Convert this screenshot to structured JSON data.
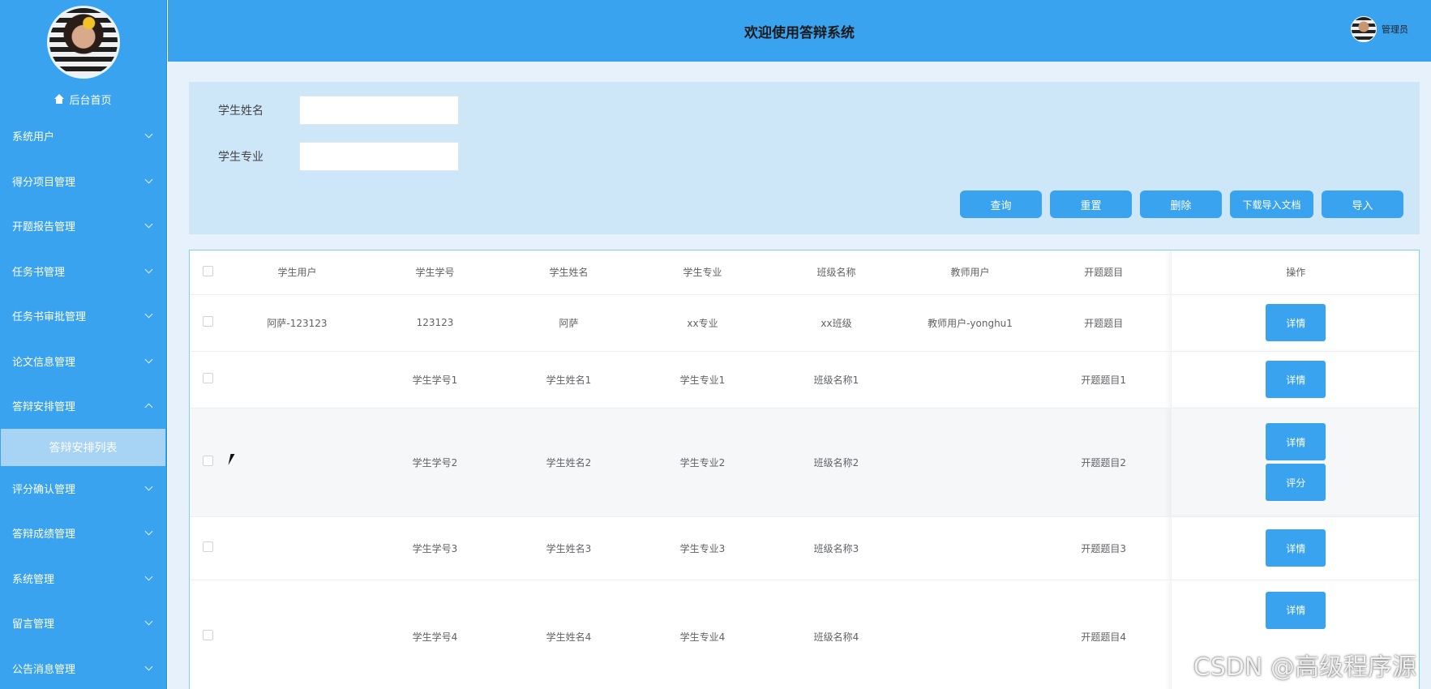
{
  "header": {
    "title": "欢迎使用答辩系统",
    "user_name": "管理员"
  },
  "sidebar": {
    "home_label": "后台首页",
    "items": [
      {
        "label": "系统用户",
        "expanded": false
      },
      {
        "label": "得分项目管理",
        "expanded": false
      },
      {
        "label": "开题报告管理",
        "expanded": false
      },
      {
        "label": "任务书管理",
        "expanded": false
      },
      {
        "label": "任务书审批管理",
        "expanded": false
      },
      {
        "label": "论文信息管理",
        "expanded": false
      },
      {
        "label": "答辩安排管理",
        "expanded": true
      }
    ],
    "submenu_active": "答辩安排列表",
    "items_after": [
      {
        "label": "评分确认管理"
      },
      {
        "label": "答辩成绩管理"
      },
      {
        "label": "系统管理"
      },
      {
        "label": "留言管理"
      },
      {
        "label": "公告消息管理"
      }
    ]
  },
  "search": {
    "name_label": "学生姓名",
    "name_value": "",
    "major_label": "学生专业",
    "major_value": "",
    "buttons": {
      "query": "查询",
      "reset": "重置",
      "delete": "删除",
      "download_template": "下载导入文档",
      "import": "导入"
    }
  },
  "table": {
    "columns": [
      "学生用户",
      "学生学号",
      "学生姓名",
      "学生专业",
      "班级名称",
      "教师用户",
      "开题题目",
      "操作"
    ],
    "rows": [
      {
        "cells": [
          "阿萨-123123",
          "123123",
          "阿萨",
          "xx专业",
          "xx班级",
          "教师用户-yonghu1",
          "开题题目"
        ],
        "actions": [
          "详情"
        ]
      },
      {
        "cells": [
          "",
          "学生学号1",
          "学生姓名1",
          "学生专业1",
          "班级名称1",
          "",
          "开题题目1"
        ],
        "actions": [
          "详情"
        ]
      },
      {
        "cells": [
          "",
          "学生学号2",
          "学生姓名2",
          "学生专业2",
          "班级名称2",
          "",
          "开题题目2"
        ],
        "actions": [
          "详情",
          "评分"
        ]
      },
      {
        "cells": [
          "",
          "学生学号3",
          "学生姓名3",
          "学生专业3",
          "班级名称3",
          "",
          "开题题目3"
        ],
        "actions": [
          "详情"
        ]
      },
      {
        "cells": [
          "",
          "学生学号4",
          "学生姓名4",
          "学生专业4",
          "班级名称4",
          "",
          "开题题目4"
        ],
        "actions": [
          "详情"
        ]
      }
    ]
  },
  "watermark": "CSDN @高级程序源",
  "colors": {
    "primary": "#3aa3f0",
    "panel": "#cde6f8",
    "stripe": "#f6f7f9"
  }
}
